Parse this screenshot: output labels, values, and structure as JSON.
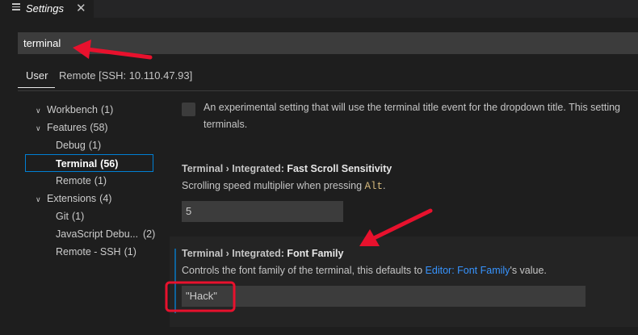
{
  "tab": {
    "title": "Settings",
    "close_glyph": "✕",
    "icon": "menu-lines-icon"
  },
  "search": {
    "value": "terminal"
  },
  "scope_tabs": {
    "user": "User",
    "remote": "Remote [SSH: 10.110.47.93]"
  },
  "toc": {
    "items": [
      {
        "label": "Workbench",
        "count": "(1)",
        "twisty": "∨"
      },
      {
        "label": "Features",
        "count": "(58)",
        "twisty": "∨"
      },
      {
        "label": "Debug",
        "count": "(1)"
      },
      {
        "label": "Terminal",
        "count": "(56)"
      },
      {
        "label": "Remote",
        "count": "(1)"
      },
      {
        "label": "Extensions",
        "count": "(4)",
        "twisty": "∨"
      },
      {
        "label": "Git",
        "count": "(1)"
      },
      {
        "label": "JavaScript Debu...",
        "count": "(2)"
      },
      {
        "label": "Remote - SSH",
        "count": "(1)"
      }
    ]
  },
  "settings": {
    "experimental": {
      "desc_line1": "An experimental setting that will use the terminal title event for the dropdown title. This setting",
      "desc_line2": "terminals."
    },
    "scroll": {
      "category": "Terminal › Integrated: ",
      "name": "Fast Scroll Sensitivity",
      "desc": "Scrolling speed multiplier when pressing ",
      "key": "Alt",
      "desc_end": ".",
      "value": "5"
    },
    "font_family": {
      "category": "Terminal › Integrated: ",
      "name": "Font Family",
      "desc_start": "Controls the font family of the terminal, this defaults to ",
      "link": "Editor: Font Family",
      "desc_end": "'s value.",
      "value": "\"Hack\""
    }
  },
  "colors": {
    "annotation": "#e8112d",
    "focus": "#0e639c",
    "selected_border": "#007fd4"
  }
}
